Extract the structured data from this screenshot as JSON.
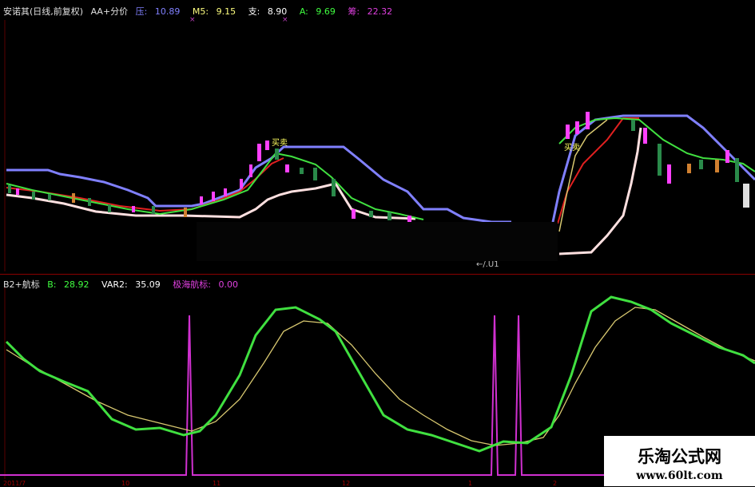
{
  "header": {
    "title": "安诺其(日线,前复权)",
    "indicator": "AA+分价",
    "items": [
      {
        "label": "压:",
        "value": "10.89",
        "color": "#8080ff"
      },
      {
        "label": "M5:",
        "value": "9.15",
        "color": "#ffff80"
      },
      {
        "label": "支:",
        "value": "8.90",
        "color": "#ffffff"
      },
      {
        "label": "A:",
        "value": "9.69",
        "color": "#40ff40"
      },
      {
        "label": "筹:",
        "value": "22.32",
        "color": "#e040e0"
      }
    ]
  },
  "indicator_header": {
    "title": "B2+航标",
    "items": [
      {
        "label": "B:",
        "value": "28.92",
        "color": "#40ff40"
      },
      {
        "label": "VAR2:",
        "value": "35.09",
        "color": "#ffffff"
      },
      {
        "label": "极海航标:",
        "value": "0.00",
        "color": "#e040e0"
      }
    ]
  },
  "annotations": {
    "buy1": "买卖",
    "buy2": "买卖",
    "cursor": "←/.U1"
  },
  "bottom_axis": {
    "labels": [
      "2011/7",
      "10",
      "11",
      "12",
      "1",
      "2"
    ]
  },
  "watermark": {
    "line1": "乐淘公式网",
    "line2": "www.60lt.com"
  },
  "colors": {
    "pressure": "#8080ff",
    "support": "#ffe0e0",
    "ma_green": "#40e040",
    "ma_red": "#e02020",
    "ma_gold": "#d8c870",
    "signal": "#d030d0",
    "up": "#ff40ff",
    "down": "#2a8a4a"
  }
}
